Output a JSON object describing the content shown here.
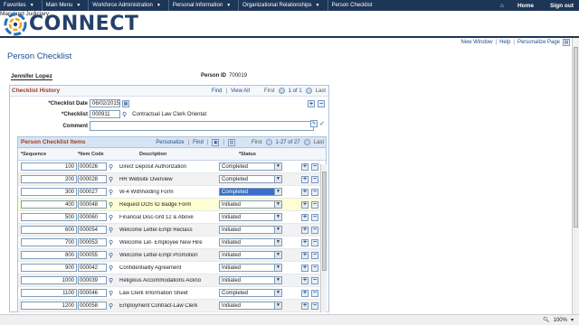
{
  "topnav": {
    "menus": [
      "Favorites",
      "Main Menu",
      "Workforce Administration",
      "Personal Information",
      "Organizational Relationships",
      "Person Checklist"
    ],
    "home": "Home",
    "signout": "Sign out"
  },
  "logo": {
    "word": "CONNECT",
    "sub": "Maryland Judiciary"
  },
  "pagelinks": {
    "new_window": "New Window",
    "help": "Help",
    "personalize": "Personalize Page",
    "sep": "|"
  },
  "page": {
    "title": "Person Checklist"
  },
  "person": {
    "name": "Jennifer Lopez",
    "id_label": "Person ID",
    "id_value": "700019"
  },
  "history": {
    "title": "Checklist History",
    "find": "Find",
    "view_all": "View All",
    "first": "First",
    "range": "1 of 1",
    "last": "Last",
    "date_label": "*Checklist Date",
    "date_value": "06/02/2015",
    "checklist_label": "*Checklist",
    "checklist_value": "000911",
    "checklist_desc": "Contractual Law Clerk Orientat",
    "comment_label": "Comment"
  },
  "items": {
    "title": "Person Checklist Items",
    "personalize": "Personalize",
    "find": "Find",
    "first": "First",
    "range": "1-27 of 27",
    "last": "Last",
    "col_seq": "*Sequence",
    "col_code": "*Item Code",
    "col_desc": "Description",
    "col_status": "*Status",
    "rows": [
      {
        "seq": "100",
        "code": "000026",
        "desc": "Direct Deposit Authorization",
        "status": "Completed"
      },
      {
        "seq": "200",
        "code": "000028",
        "desc": "HR Website Overview",
        "status": "Completed"
      },
      {
        "seq": "300",
        "code": "000027",
        "desc": "W-4 Withholding Form",
        "status": "Completed"
      },
      {
        "seq": "400",
        "code": "000048",
        "desc": "Request DOS ID Badge Form",
        "status": "Initiated"
      },
      {
        "seq": "500",
        "code": "000060",
        "desc": "Financial Disc-Grd 12 & Above",
        "status": "Initiated"
      },
      {
        "seq": "600",
        "code": "000054",
        "desc": "Welcome Letter-Empl Reclass",
        "status": "Initiated"
      },
      {
        "seq": "700",
        "code": "000053",
        "desc": "Welcome Let- Employee New Hire",
        "status": "Initiated"
      },
      {
        "seq": "800",
        "code": "000055",
        "desc": "Welcome Letter-Empl Promotion",
        "status": "Initiated"
      },
      {
        "seq": "900",
        "code": "000042",
        "desc": "Confidentiality Agreement",
        "status": "Initiated"
      },
      {
        "seq": "1000",
        "code": "000039",
        "desc": "Religious Accommodations Ackno",
        "status": "Initiated"
      },
      {
        "seq": "1100",
        "code": "000046",
        "desc": "Law Clerk Information Sheet",
        "status": "Completed"
      },
      {
        "seq": "1200",
        "code": "000058",
        "desc": "Employment Contract-Law Clerk",
        "status": "Initiated"
      }
    ]
  },
  "statusbar": {
    "zoom": "100%"
  }
}
